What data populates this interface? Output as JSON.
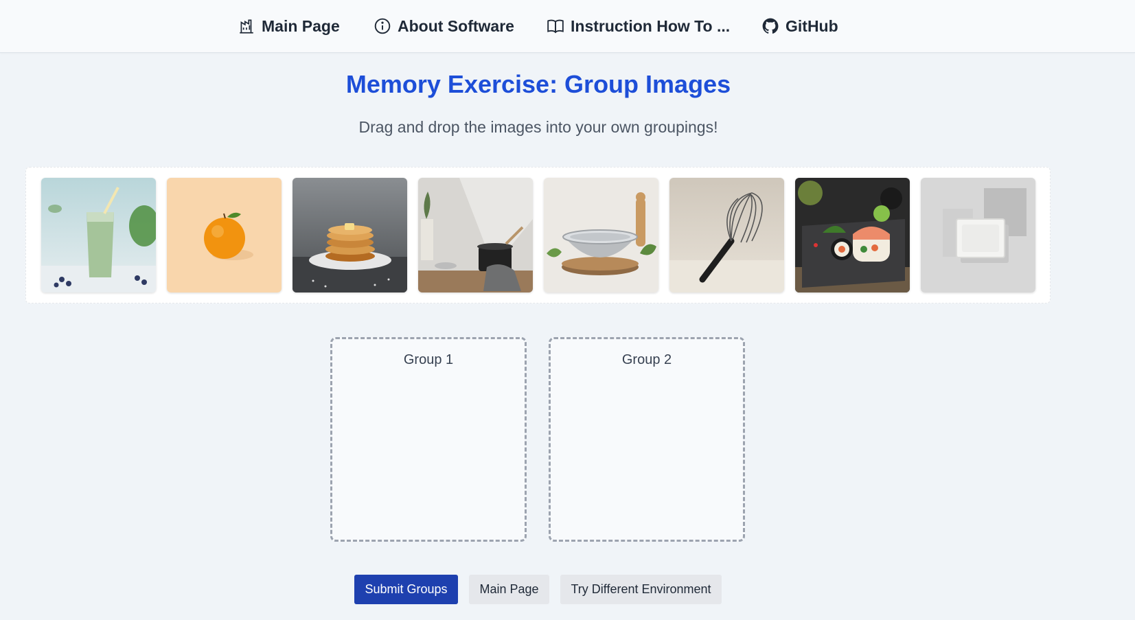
{
  "nav": {
    "items": [
      {
        "label": "Main Page",
        "icon": "building-chart-icon"
      },
      {
        "label": "About Software",
        "icon": "info-circle-icon"
      },
      {
        "label": "Instruction How To ...",
        "icon": "open-book-icon"
      },
      {
        "label": "GitHub",
        "icon": "github-icon"
      }
    ]
  },
  "header": {
    "title": "Memory Exercise: Group Images",
    "subtitle": "Drag and drop the images into your own groupings!"
  },
  "images": [
    {
      "subject": "green smoothie with blueberries"
    },
    {
      "subject": "orange on peach background"
    },
    {
      "subject": "pancake stack with syrup"
    },
    {
      "subject": "kitchen shelf with pot and utensils"
    },
    {
      "subject": "metal colander on wooden board"
    },
    {
      "subject": "wire whisk"
    },
    {
      "subject": "sushi rolls on slate"
    },
    {
      "subject": "white cutting board on grey"
    }
  ],
  "groups": [
    {
      "label": "Group 1"
    },
    {
      "label": "Group 2"
    }
  ],
  "buttons": {
    "submit": "Submit Groups",
    "main": "Main Page",
    "try_different": "Try Different Environment"
  },
  "colors": {
    "accent": "#1d4ed8",
    "primary_button": "#1e40af",
    "secondary_button": "#e5e7eb",
    "background": "#f0f4f8"
  }
}
